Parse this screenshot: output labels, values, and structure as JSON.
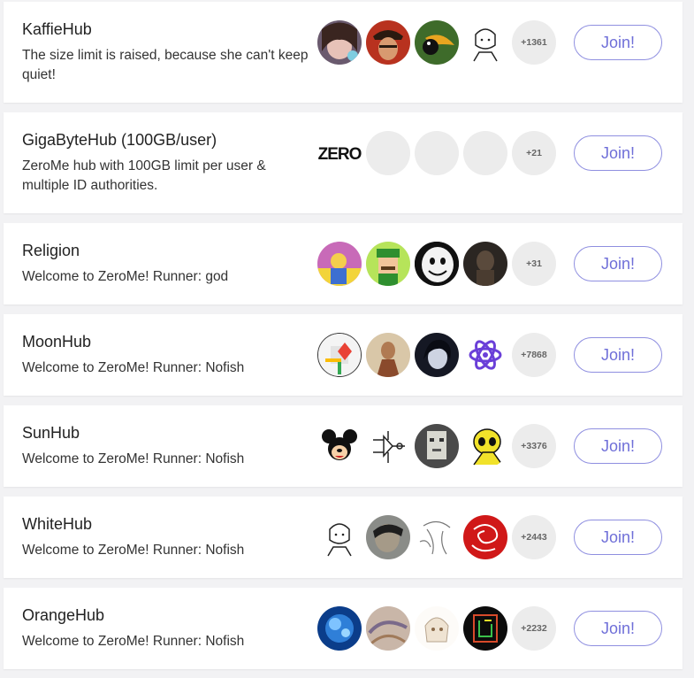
{
  "hubs": [
    {
      "title": "KaffieHub",
      "desc": "The size limit is raised, because she can't keep quiet!",
      "count": "+1361",
      "join": "Join!",
      "avatars": [
        "anime-girl-avatar",
        "pirate-avatar",
        "toucan-avatar",
        "sketch-boy-avatar"
      ]
    },
    {
      "title": "GigaByteHub (100GB/user)",
      "desc": "ZeroMe hub with 100GB limit per user & multiple ID authorities.",
      "count": "+21",
      "join": "Join!",
      "avatars": [
        "zero-logo-avatar",
        "empty-avatar",
        "empty-avatar",
        "empty-avatar"
      ]
    },
    {
      "title": "Religion",
      "desc": "Welcome to ZeroMe! Runner: god",
      "count": "+31",
      "join": "Join!",
      "avatars": [
        "cartoon-man-avatar",
        "pixel-luigi-avatar",
        "white-face-avatar",
        "creature-avatar"
      ]
    },
    {
      "title": "MoonHub",
      "desc": "Welcome to ZeroMe! Runner: Nofish",
      "count": "+7868",
      "join": "Join!",
      "avatars": [
        "maps-icon-avatar",
        "portrait-avatar",
        "dark-hair-avatar",
        "atom-avatar"
      ]
    },
    {
      "title": "SunHub",
      "desc": "Welcome to ZeroMe! Runner: Nofish",
      "count": "+3376",
      "join": "Join!",
      "avatars": [
        "mickey-avatar",
        "circuit-avatar",
        "pixel-face-avatar",
        "yellow-skull-avatar"
      ]
    },
    {
      "title": "WhiteHub",
      "desc": "Welcome to ZeroMe! Runner: Nofish",
      "count": "+2443",
      "join": "Join!",
      "avatars": [
        "sketch-boy-avatar",
        "photo-face-avatar",
        "sketch-girl-avatar",
        "red-dragon-avatar"
      ]
    },
    {
      "title": "OrangeHub",
      "desc": "Welcome to ZeroMe! Runner: Nofish",
      "count": "+2232",
      "join": "Join!",
      "avatars": [
        "blue-fractal-avatar",
        "abstract-avatar",
        "anime-sketch-avatar",
        "maze-avatar"
      ]
    }
  ]
}
